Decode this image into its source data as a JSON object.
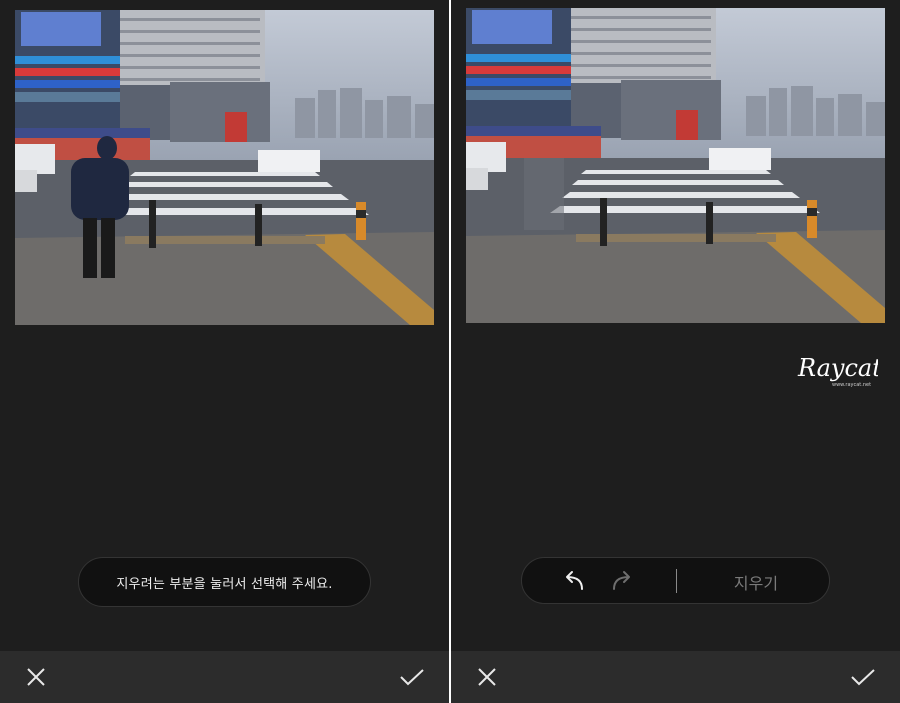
{
  "left_screen": {
    "hint_text": "지우려는 부분을 눌러서 선택해 주세요.",
    "icons": {
      "close": "close-icon",
      "confirm": "check-icon"
    }
  },
  "right_screen": {
    "toolbar": {
      "undo_icon": "undo-icon",
      "redo_icon": "redo-icon",
      "erase_label": "지우기"
    },
    "watermark": {
      "text": "Raycat",
      "subtext": "www.raycat.net"
    },
    "icons": {
      "close": "close-icon",
      "confirm": "check-icon"
    }
  },
  "colors": {
    "background": "#1e1e1e",
    "bottom_bar": "#2c2c2c",
    "pill": "#111111",
    "disabled_text": "#7a7a7a"
  }
}
